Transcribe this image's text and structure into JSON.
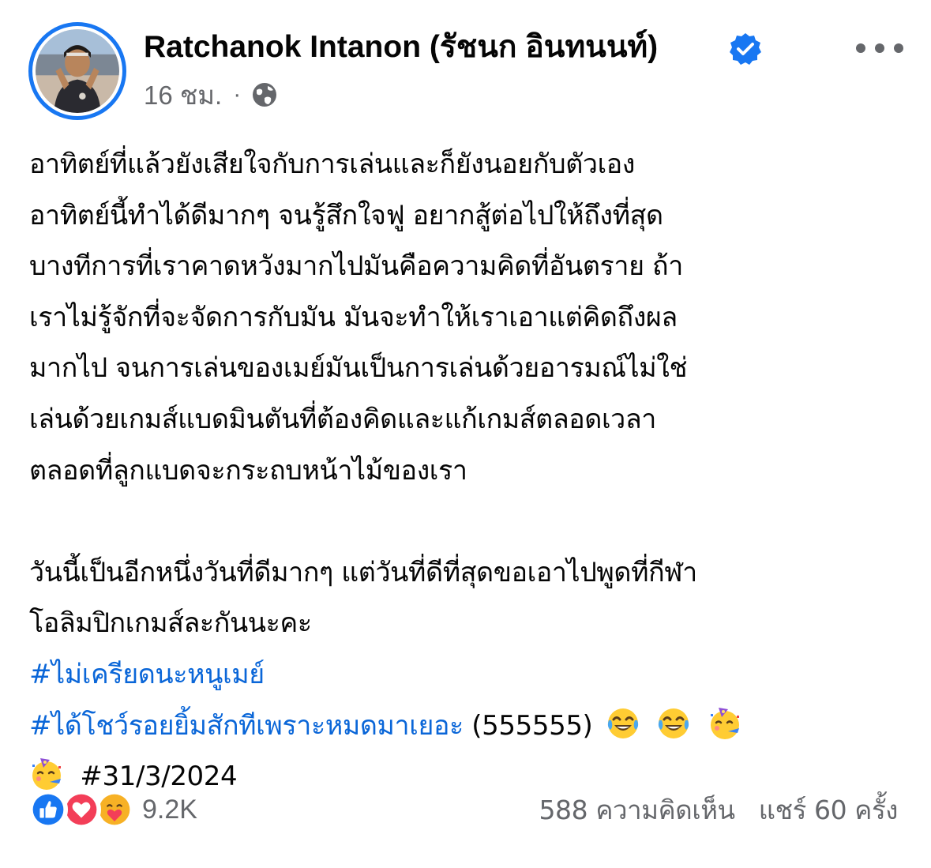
{
  "post": {
    "author": {
      "name": "Ratchanok Intanon (รัชนก อินทนนท์)",
      "verified": true
    },
    "timestamp": "16 ชม.",
    "separator": "·",
    "audience_icon": "globe-icon",
    "body_lines": [
      "อาทิตย์ที่แล้วยังเสียใจกับการเล่นและก็ยังนอยกับตัวเอง",
      "อาทิตย์นี้ทำได้ดีมากๆ จนรู้สึกใจฟู อยากสู้ต่อไปให้ถึงที่สุด",
      "บางทีการที่เราคาดหวังมากไปมันคือความคิดที่อันตราย ถ้า",
      "เราไม่รู้จักที่จะจัดการกับมัน มันจะทำให้เราเอาแต่คิดถึงผล",
      "มากไป จนการเล่นของเมย์มันเป็นการเล่นด้วยอารมณ์ไม่ใช่",
      "เล่นด้วยเกมส์แบดมินตันที่ต้องคิดและแก้เกมส์ตลอดเวลา",
      "ตลอดที่ลูกแบดจะกระถบหน้าไม้ของเรา"
    ],
    "body_lines_2": [
      "วันนี้เป็นอีกหนึ่งวันที่ดีมากๆ แต่วันที่ดีที่สุดขอเอาไปพูดที่กีฬา",
      "โอลิมปิกเกมส์ละกันนะคะ"
    ],
    "hashtag_1": "#ไม่เครียดนะหนูเมย์",
    "hashtag_2": "#ได้โชว์รอยยิ้มสักทีเพราะหมดมาเยอะ",
    "hashtag_2_suffix": "(555555)",
    "hashtag_3": "#31/3/2024",
    "emojis": [
      "tears-of-joy",
      "tears-of-joy",
      "partying-face",
      "partying-face"
    ],
    "reactions": {
      "icons": [
        "like-icon",
        "love-icon",
        "care-icon"
      ],
      "count": "9.2K"
    },
    "comments": "588 ความคิดเห็น",
    "shares": "แชร์ 60 ครั้ง"
  },
  "colors": {
    "accent": "#1877f2",
    "hashtag": "#0a66d8",
    "secondary_text": "#65676b",
    "love": "#f33e58",
    "care": "#f7b125"
  }
}
